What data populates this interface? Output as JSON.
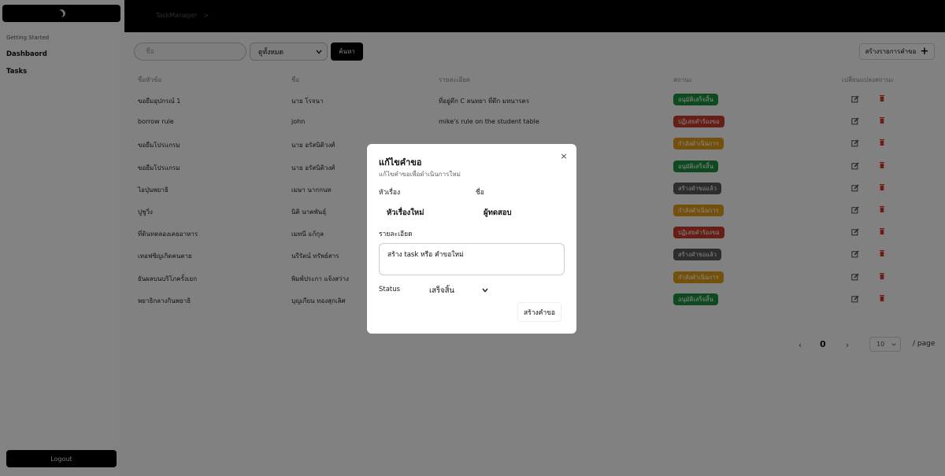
{
  "sidebar": {
    "caption": "Getting Started",
    "items": [
      {
        "label": "Dashbaord"
      },
      {
        "label": "Tasks"
      }
    ],
    "logout_label": "Logout"
  },
  "topbar": {
    "breadcrumb": "TaskManager",
    "breadcrumb_sep": ">"
  },
  "toolbar": {
    "search_placeholder": "ชื่อ",
    "status_filter": "ดูทั้งหมด",
    "search_label": "ค้นหา",
    "create_label": "สร้างรายการคำขอ"
  },
  "table": {
    "headers": [
      "ชื่อหัวข้อ",
      "ชื่อ",
      "รายละเอียด",
      "สถานะ",
      "เปลี่ยนแปลงสถานะ"
    ],
    "rows": [
      {
        "title": "ขอยืมอุปกรณ์ 1",
        "name": "นาย โรจนา",
        "detail": "ที่อยู่ตึก C ลนทยา ที่ตึก มหนารตร",
        "status": "อนุมัติเสร็จสิ้น",
        "status_color": "#1e8a3e"
      },
      {
        "title": "borrow rule",
        "name": "john",
        "detail": "mike's rule on the student table",
        "status": "ปฏิเสธคำร้องขอ",
        "status_color": "#c0392b"
      },
      {
        "title": "ขอยืมโปรแกรม",
        "name": "นาย อรัสนิติวงศ์",
        "detail": "",
        "status": "กำลังดำเนินการ",
        "status_color": "#d99a1a"
      },
      {
        "title": "ขอยืมโปรแกรม",
        "name": "นาย อรัสนิติวงศ์",
        "detail": "",
        "status": "อนุมัติเสร็จสิ้น",
        "status_color": "#1e8a3e"
      },
      {
        "title": "ไอปุ่นพยาธิ",
        "name": "เมษา นากกนท",
        "detail": "",
        "status": "สร้างคำขอแล้ว",
        "status_color": "#555555"
      },
      {
        "title": "ปูชูวิ่ง",
        "name": "นิติ นาคพันธุ์",
        "detail": "",
        "status": "กำลังดำเนินการ",
        "status_color": "#d99a1a"
      },
      {
        "title": "ที่ดินทดลองเคยอาหาร",
        "name": "เมทนี แก้กุล",
        "detail": "",
        "status": "ปฏิเสธคำร้องขอ",
        "status_color": "#c0392b"
      },
      {
        "title": "เทอฟซิญเกิดคนตาย",
        "name": "นรีรัตน์ ทรัพย์สาร",
        "detail": "",
        "status": "สร้างคำขอแล้ว",
        "status_color": "#555555"
      },
      {
        "title": "ยันผลบนบริโภครั้งเยก",
        "name": "พิมพ์ประกา แจ้งสว่าง",
        "detail": "",
        "status": "กำลังดำเนินการ",
        "status_color": "#d99a1a"
      },
      {
        "title": "พยาธิกลางกินพยาธิ",
        "name": "บุญเกียน ทองสุกเลิศ",
        "detail": "",
        "status": "อนุมัติเสร็จสิ้น",
        "status_color": "#1e8a3e"
      }
    ]
  },
  "pagination": {
    "prev": "‹",
    "current": "0",
    "next": "›",
    "page_size": "10",
    "unit": "/ page"
  },
  "modal": {
    "title": "แก้ไขคำขอ",
    "subtitle": "แก้ไขคำขอเพื่อดำเนินการใหม่",
    "close": "×",
    "topic_label": "หัวเรื่อง",
    "topic_value": "หัวเรื่องใหม่",
    "name_label": "ชื่อ",
    "name_value": "ผู้ทดสอบ",
    "detail_label": "รายละเอียด",
    "detail_value": "สร้าง task หรือ คำขอใหม่",
    "status_label": "Status",
    "status_value": "เสร็จสิ้น",
    "submit_label": "สร้างคำขอ"
  }
}
